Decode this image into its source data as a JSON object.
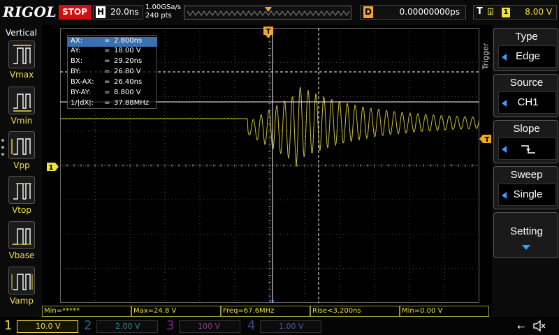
{
  "brand": "RIGOL",
  "status": "STOP",
  "horizontal": {
    "key": "H",
    "timebase": "20.0ns",
    "sample_rate": "1.00GSa/s",
    "points": "240 pts"
  },
  "delay": {
    "key": "D",
    "value": "0.00000000ps"
  },
  "trigger_header": {
    "key": "T",
    "channel": "1",
    "level": "8.00 V"
  },
  "left_panel": {
    "title": "Vertical",
    "items": [
      {
        "label": "Vmax"
      },
      {
        "label": "Vmin"
      },
      {
        "label": "Vpp"
      },
      {
        "label": "Vtop"
      },
      {
        "label": "Vbase"
      },
      {
        "label": "Vamp"
      }
    ]
  },
  "cursor": {
    "rows": [
      {
        "name": "AX:",
        "eq": "=",
        "value": "2.800ns"
      },
      {
        "name": "AY:",
        "eq": "=",
        "value": "18.00 V"
      },
      {
        "name": "BX:",
        "eq": "=",
        "value": "29.20ns"
      },
      {
        "name": "BY:",
        "eq": "=",
        "value": "26.80 V"
      },
      {
        "name": "BX-AX:",
        "eq": "=",
        "value": "26.40ns"
      },
      {
        "name": "BY-AY:",
        "eq": "=",
        "value": "8.800 V"
      },
      {
        "name": "1/|dX|:",
        "eq": "=",
        "value": "37.88MHz"
      }
    ]
  },
  "markers": {
    "trigger_pos": "T",
    "channel_ground": "1",
    "trigger_level": "T"
  },
  "measurements": [
    {
      "text": "Min=*****"
    },
    {
      "text": "Max=24.8 V"
    },
    {
      "text": "Freq=67.6MHz"
    },
    {
      "text": "Rise<3.200ns"
    },
    {
      "text": "Min=0.00 V"
    }
  ],
  "channels": [
    {
      "num": "1",
      "scale": "10.0 V",
      "color": "#f0e040"
    },
    {
      "num": "2",
      "scale": "2.00 V",
      "color": "#2fb6b6"
    },
    {
      "num": "3",
      "scale": "100 V",
      "color": "#c040c0"
    },
    {
      "num": "4",
      "scale": "1.00 V",
      "color": "#4a70d0"
    }
  ],
  "right_menu": {
    "section": "Trigger",
    "items": [
      {
        "title": "Type",
        "value": "Edge"
      },
      {
        "title": "Source",
        "value": "CH1"
      },
      {
        "title": "Slope",
        "value": ""
      },
      {
        "title": "Sweep",
        "value": "Single"
      },
      {
        "title": "Setting",
        "value": ""
      }
    ]
  },
  "colors": {
    "ch1": "#f0e040",
    "trigger": "#f5a623",
    "stop": "#d01010",
    "accent": "#3aa0ff"
  }
}
